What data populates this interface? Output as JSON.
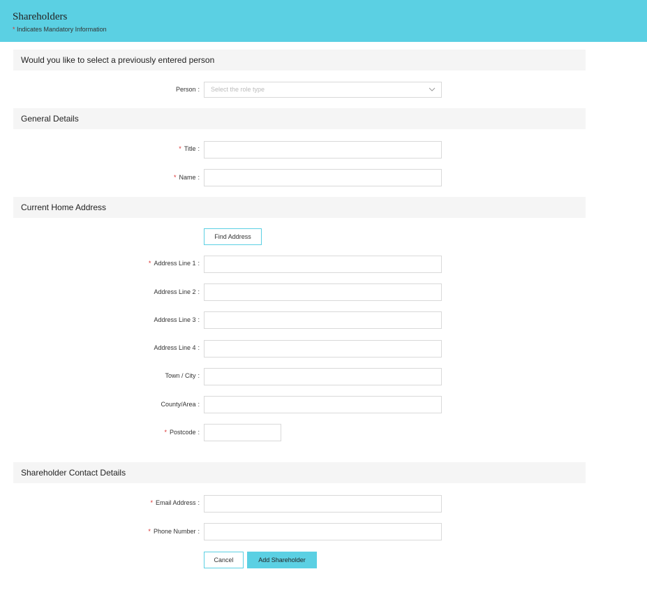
{
  "header": {
    "title": "Shareholders",
    "mandatory_star": "*",
    "mandatory_note": "Indicates Mandatory Information"
  },
  "sections": {
    "previous_person": "Would you like to select a previously entered person",
    "general_details": "General Details",
    "home_address": "Current Home Address",
    "contact_details": "Shareholder Contact Details"
  },
  "person": {
    "label": "Person",
    "placeholder": "Select the role type"
  },
  "fields": {
    "title": {
      "label": "Title",
      "required": true,
      "value": ""
    },
    "name": {
      "label": "Name",
      "required": true,
      "value": ""
    },
    "address1": {
      "label": "Address Line 1",
      "required": true,
      "value": ""
    },
    "address2": {
      "label": "Address Line 2",
      "required": false,
      "value": ""
    },
    "address3": {
      "label": "Address Line 3",
      "required": false,
      "value": ""
    },
    "address4": {
      "label": "Address Line 4",
      "required": false,
      "value": ""
    },
    "town": {
      "label": "Town / City",
      "required": false,
      "value": ""
    },
    "county": {
      "label": "County/Area",
      "required": false,
      "value": ""
    },
    "postcode": {
      "label": "Postcode",
      "required": true,
      "value": ""
    },
    "email": {
      "label": "Email Address",
      "required": true,
      "value": ""
    },
    "phone": {
      "label": "Phone Number",
      "required": true,
      "value": ""
    }
  },
  "buttons": {
    "find_address": "Find Address",
    "cancel": "Cancel",
    "add_shareholder": "Add Shareholder"
  },
  "common": {
    "star": "*",
    "colon": ":"
  },
  "colors": {
    "accent": "#5bd0e3",
    "required_star": "#d9302f",
    "section_bg": "#f5f5f5"
  }
}
